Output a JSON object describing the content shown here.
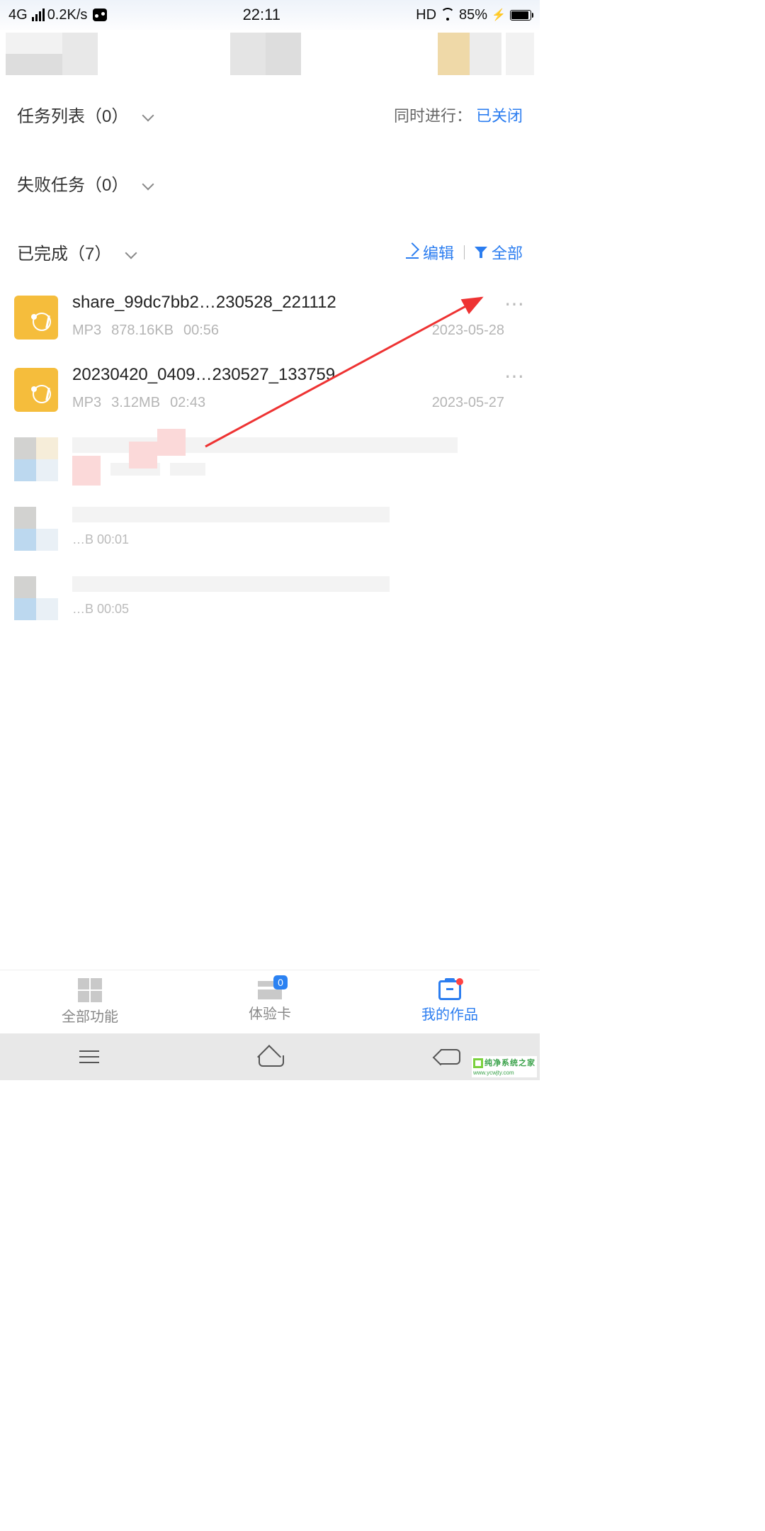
{
  "statusbar": {
    "network": "4G",
    "speed": "0.2K/s",
    "time": "22:11",
    "hd": "HD",
    "battery_pct": "85%"
  },
  "sections": {
    "task_list": {
      "label": "任务列表（0）"
    },
    "failed": {
      "label": "失败任务（0）"
    },
    "completed": {
      "label": "已完成（7）"
    },
    "concurrent_label": "同时进行：",
    "concurrent_value": "已关闭",
    "edit_label": "编辑",
    "filter_label": "全部"
  },
  "files": [
    {
      "title": "share_99dc7bb2…230528_221112",
      "format": "MP3",
      "size": "878.16KB",
      "duration": "00:56",
      "date": "2023-05-28"
    },
    {
      "title": "20230420_0409…230527_133759",
      "format": "MP3",
      "size": "3.12MB",
      "duration": "02:43",
      "date": "2023-05-27"
    }
  ],
  "blurred_meta": {
    "partial_text_1": "…B  00:01",
    "partial_text_2": "…B  00:05"
  },
  "bottom_nav": {
    "items": [
      {
        "label": "全部功能"
      },
      {
        "label": "体验卡",
        "badge": "0"
      },
      {
        "label": "我的作品"
      }
    ]
  },
  "watermark": {
    "line1": "纯净系统之家",
    "line2": "www.ycwjty.com"
  }
}
